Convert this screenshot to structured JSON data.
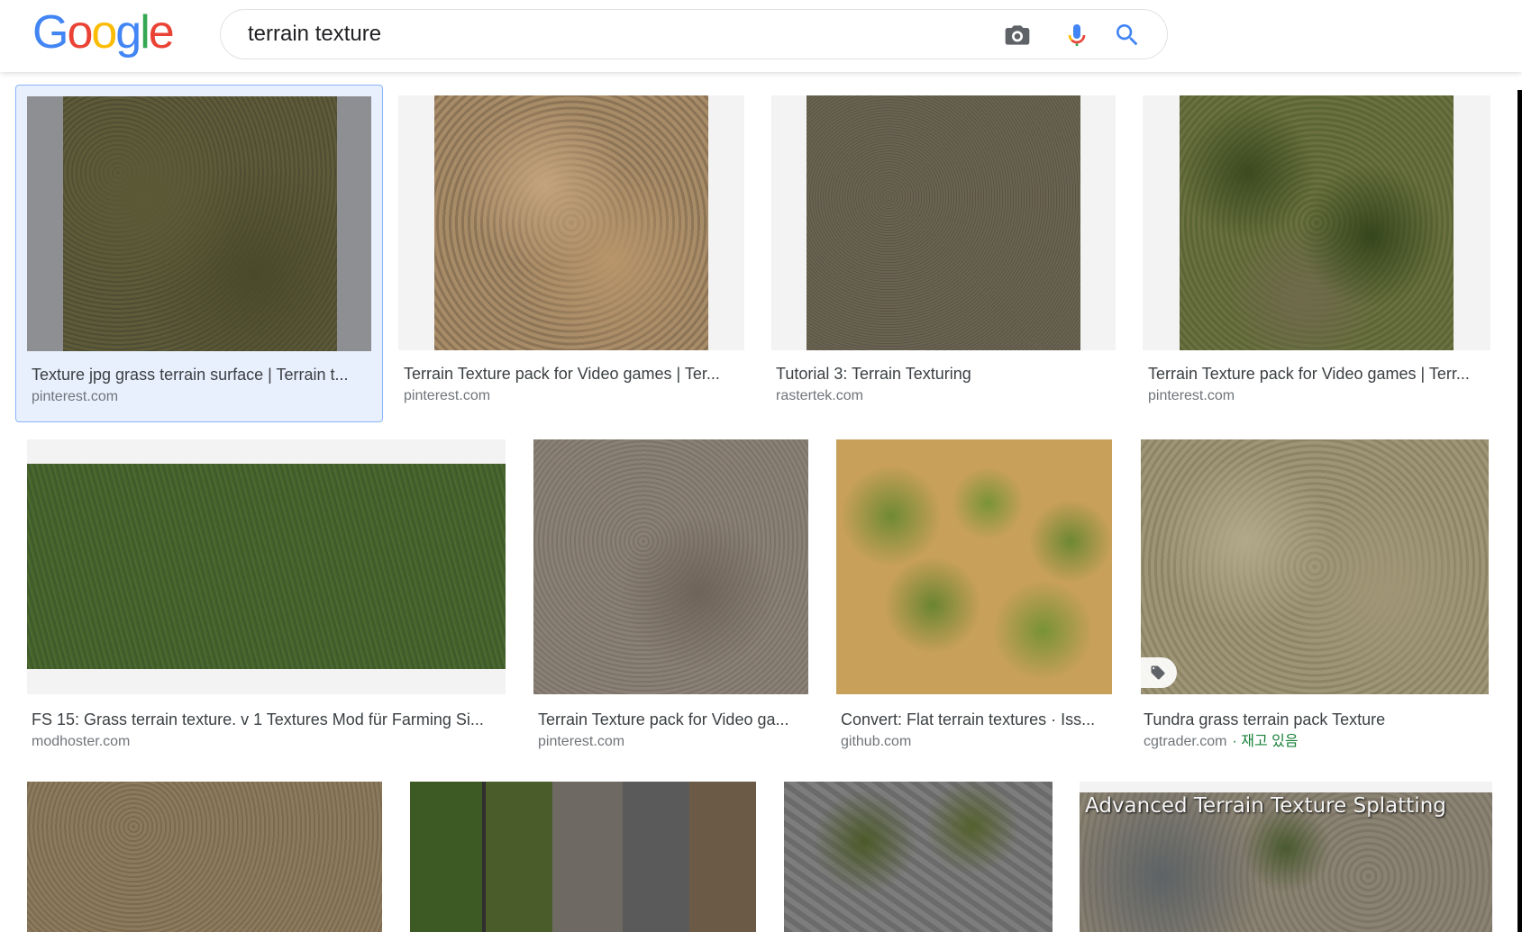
{
  "header": {
    "logo_letters": [
      "G",
      "o",
      "o",
      "g",
      "l",
      "e"
    ],
    "logo_colors": [
      "#4285F4",
      "#EA4335",
      "#FBBC05",
      "#4285F4",
      "#34A853",
      "#EA4335"
    ],
    "search_value": "terrain texture",
    "camera_icon": "camera-icon",
    "mic_icon": "microphone-icon",
    "search_icon": "search-icon"
  },
  "results": [
    {
      "caption": "Texture jpg grass terrain surface | Terrain t...",
      "source": "pinterest.com",
      "selected": true
    },
    {
      "caption": "Terrain Texture pack for Video games | Ter...",
      "source": "pinterest.com"
    },
    {
      "caption": "Tutorial 3: Terrain Texturing",
      "source": "rastertek.com"
    },
    {
      "caption": "Terrain Texture pack for Video games | Terr...",
      "source": "pinterest.com"
    },
    {
      "caption": "FS 15: Grass terrain texture. v 1 Textures Mod für Farming Si...",
      "source": "modhoster.com"
    },
    {
      "caption": "Terrain Texture pack for Video ga...",
      "source": "pinterest.com"
    },
    {
      "caption": "Convert: Flat terrain textures · Iss...",
      "source": "github.com"
    },
    {
      "caption": "Tundra grass terrain pack Texture",
      "source": "cgtrader.com",
      "stock": "· 재고 있음",
      "tag_icon": "tag-icon"
    },
    {
      "caption": "",
      "source": ""
    },
    {
      "caption": "",
      "source": ""
    },
    {
      "caption": "",
      "source": ""
    },
    {
      "caption": "",
      "source": "",
      "overlay": "Advanced Terrain Texture Splatting"
    }
  ],
  "colors": {
    "selected_bg": "#e8f0fe",
    "selected_border": "#8ab4f8",
    "source_green": "#188038"
  }
}
